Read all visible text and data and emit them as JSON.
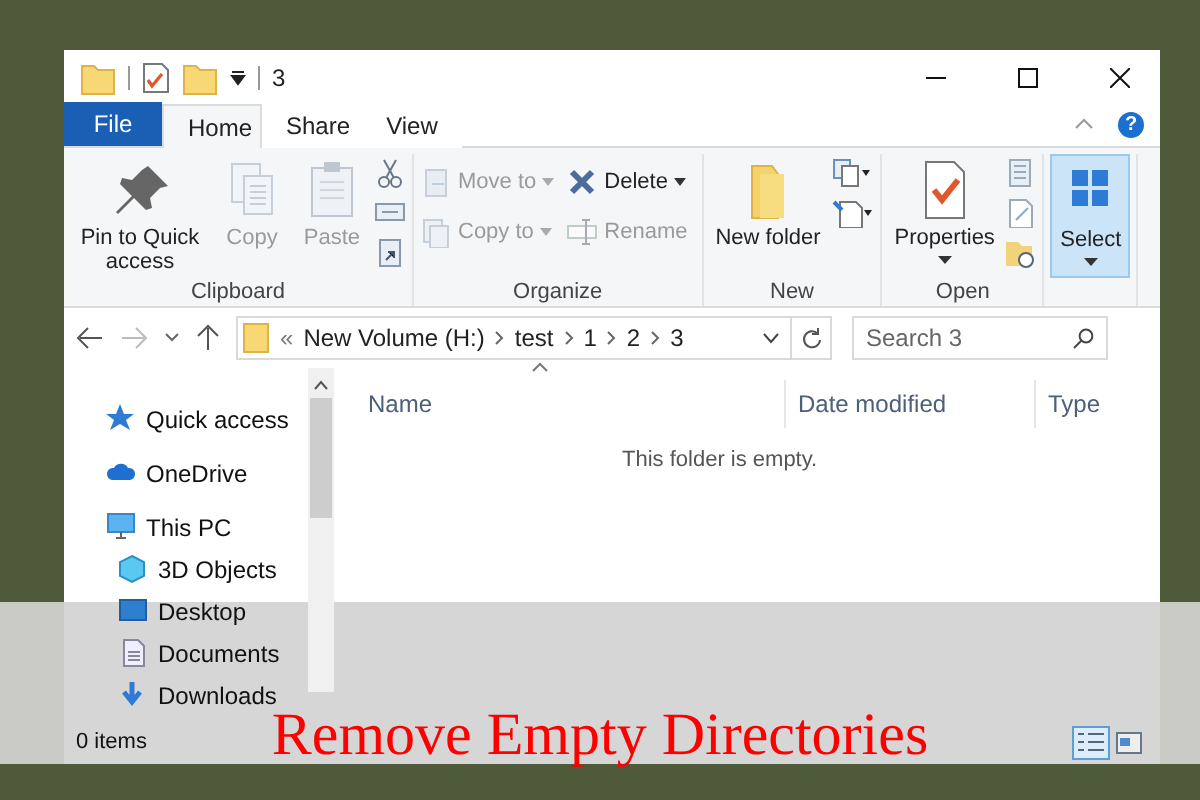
{
  "window": {
    "title": "3"
  },
  "tabs": [
    {
      "label": "File",
      "kind": "file",
      "selected": false
    },
    {
      "label": "Home",
      "kind": "tab",
      "selected": true
    },
    {
      "label": "Share",
      "kind": "tab",
      "selected": false
    },
    {
      "label": "View",
      "kind": "tab",
      "selected": false
    }
  ],
  "help_button": {
    "label": "?"
  },
  "ribbon": {
    "groups": [
      {
        "label": "Clipboard",
        "items": [
          {
            "label": "Pin to Quick access",
            "kind": "large",
            "disabled": false,
            "has_menu": false
          },
          {
            "label": "Copy",
            "kind": "large",
            "disabled": true,
            "has_menu": false
          },
          {
            "label": "Paste",
            "kind": "large",
            "disabled": true,
            "has_menu": false
          }
        ]
      },
      {
        "label": "Organize",
        "items": [
          {
            "label": "Move to",
            "kind": "small",
            "disabled": true,
            "has_menu": true
          },
          {
            "label": "Copy to",
            "kind": "small",
            "disabled": true,
            "has_menu": true
          },
          {
            "label": "Delete",
            "kind": "small",
            "disabled": false,
            "has_menu": true
          },
          {
            "label": "Rename",
            "kind": "small",
            "disabled": true,
            "has_menu": false
          }
        ]
      },
      {
        "label": "New",
        "items": [
          {
            "label": "New folder",
            "kind": "large",
            "disabled": false,
            "has_menu": false,
            "selected": false
          }
        ]
      },
      {
        "label": "Open",
        "items": [
          {
            "label": "Properties",
            "kind": "large",
            "disabled": false,
            "has_menu": true,
            "selected": false
          }
        ]
      },
      {
        "items": [
          {
            "label": "Select",
            "kind": "large",
            "disabled": false,
            "has_menu": true,
            "selected": true
          }
        ]
      }
    ]
  },
  "address_bar": {
    "overflow": "«",
    "crumbs": [
      "New Volume (H:)",
      "test",
      "1",
      "2",
      "3"
    ]
  },
  "search": {
    "placeholder": "Search 3"
  },
  "navigation": [
    {
      "label": "Quick access"
    },
    {
      "label": "OneDrive"
    },
    {
      "label": "This PC",
      "children": [
        {
          "label": "3D Objects"
        },
        {
          "label": "Desktop"
        },
        {
          "label": "Documents"
        },
        {
          "label": "Downloads"
        }
      ]
    }
  ],
  "columns": [
    "Name",
    "Date modified",
    "Type"
  ],
  "empty_message": "This folder is empty.",
  "status_bar": {
    "item_count": "0 items",
    "views": [
      {
        "kind": "details",
        "selected": true
      },
      {
        "kind": "large_icons",
        "selected": false
      }
    ]
  },
  "banner": {
    "title": "Remove Empty Directories"
  }
}
